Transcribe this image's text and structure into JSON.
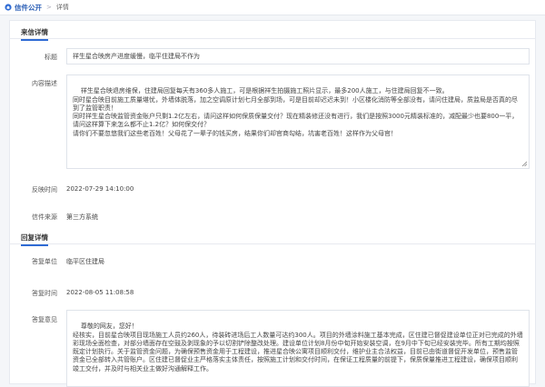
{
  "breadcrumb": {
    "main": "信件公开",
    "separator": ">",
    "sub": "详情"
  },
  "letter_section": {
    "title": "来信详情",
    "subject_label": "标题",
    "subject": "祥生星合映房产进度缓慢，临平住建局不作为",
    "content_label": "内容描述",
    "content": "祥生星合映退房维保，住建局回复每天有360多人施工，可是根据祥生拍摄施工照片显示，最多200人施工，与住建局回复不一致。\n同时星合映目前施工质量堪忧，外墙体脱落，加之空调原计划七月全部到场，可是目前却迟迟未到！小区楼化消防等全部没有，请问住建局，质监局是否真的尽到了监管职责！\n同时祥生星合映监管资金账户只剩1.2亿左右，请问这样如何保质保量交付？现在精装修还没有进行，我们是按照3000元精装标准的，减配最少也要800一平，请问这样算下来怎么都不止1.2亿？如何保交付？\n请你们不要忽悠我们这些老百姓！父母花了一辈子的钱买房，结果你们却官商勾结，坑害老百姓！这样作为父母官！",
    "time_label": "反映时间",
    "time": "2022-07-29 14:10:00",
    "source_label": "信件来源",
    "source": "第三方系统"
  },
  "reply_section": {
    "title": "回复详情",
    "unit_label": "答复单位",
    "unit": "临平区住建局",
    "time_label": "答复时间",
    "time": "2022-08-05 11:08:58",
    "opinion_label": "答复意见",
    "opinion": "尊敬的网友，您好！\n经核实，目前星合映项目现场施工人员约260人，待装砖进场后工人数量可达约300人。项目的外墙涂料施工基本完成，区住建已督促建设单位正对已完成的外墙彩现场全面检查，对部分墙面存在空鼓及剥现象的予以切割铲除整改处理。建设单位计划8月份中旬开始安装空调，在9月中下旬已经安装完毕。所有工期均按照既定计划执行。关于监管资金问题，为确保预售资金用于工程建设，推进星合映公寓项目顺利交付，维护业主合法权益，目前已由街道督促开发单位，预售监管资金已全部转入共管账户。区住建已督促业主严格落实主体责任，按照施工计划和交付时间，在保证工程质量的前提下，保质保量推进工程建设，确保项目顺利竣工交付，并及时与相关业主做好沟通解释工作。"
  },
  "colors": {
    "accent": "#2f6bd4",
    "breadcrumb": "#2b5fb6"
  }
}
